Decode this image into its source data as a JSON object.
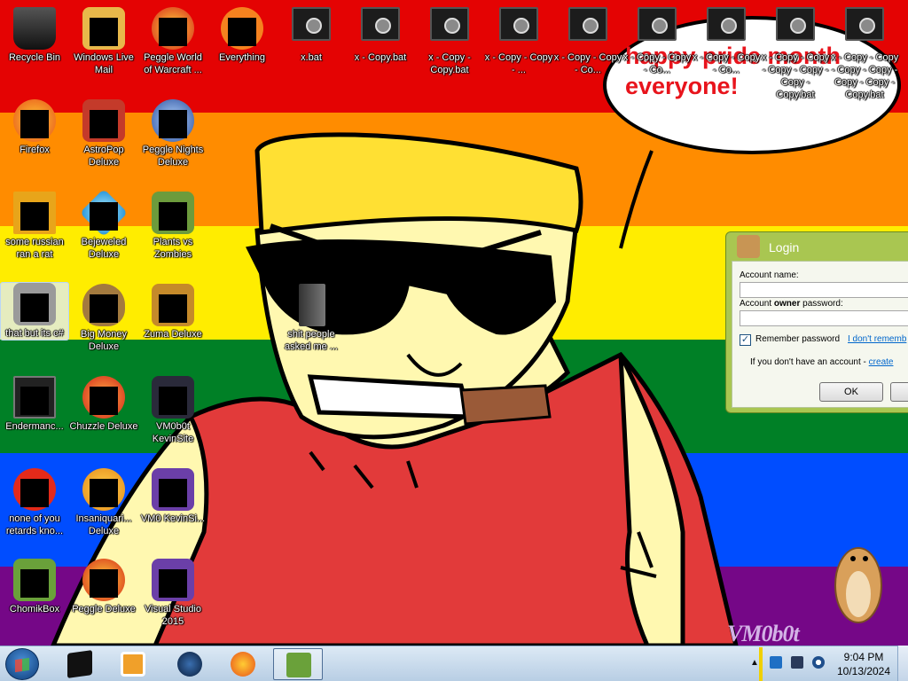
{
  "desktop": {
    "icons": [
      {
        "label": "Recycle Bin"
      },
      {
        "label": "Windows Live Mail"
      },
      {
        "label": "Peggle World of Warcraft ..."
      },
      {
        "label": "Everything"
      },
      {
        "label": "x.bat"
      },
      {
        "label": "x - Copy.bat"
      },
      {
        "label": "x - Copy - Copy.bat"
      },
      {
        "label": "x - Copy - Copy - ..."
      },
      {
        "label": "x - Copy - Copy - Co..."
      },
      {
        "label": "x - Copy - Copy - Co..."
      },
      {
        "label": "x - Copy - Copy - Co..."
      },
      {
        "label": "x - Copy - Copy - Copy - Copy - Copy - Copy.bat"
      },
      {
        "label": "x - Copy - Copy - Copy - Copy - Copy - Copy - Copy.bat"
      },
      {
        "label": "Firefox"
      },
      {
        "label": "AstroPop Deluxe"
      },
      {
        "label": "Peggle Nights Deluxe"
      },
      {
        "label": "some russian ran a rat"
      },
      {
        "label": "Bejeweled Deluxe"
      },
      {
        "label": "Plants vs Zombies"
      },
      {
        "label": "that but its c#"
      },
      {
        "label": "Big Money Deluxe"
      },
      {
        "label": "Zuma Deluxe"
      },
      {
        "label": "shit people asked me ..."
      },
      {
        "label": "Endermanc..."
      },
      {
        "label": "Chuzzle Deluxe"
      },
      {
        "label": "VM0b0t KevinSite"
      },
      {
        "label": "none of you retards kno..."
      },
      {
        "label": "Insaniquari... Deluxe"
      },
      {
        "label": "VM0 KevinSi..."
      },
      {
        "label": "ChomikBox"
      },
      {
        "label": "Peggle Deluxe"
      },
      {
        "label": "Visual Studio 2015"
      }
    ],
    "bubble_text": "happy pride month everyone!",
    "signature": "VM0b0t"
  },
  "login": {
    "title": "Login",
    "account_name_label": "Account name:",
    "password_label_pre": "Account ",
    "password_label_bold": "owner",
    "password_label_post": " password:",
    "remember_label": "Remember password",
    "remember_checked": "✓",
    "forgot_link": "I don't rememb",
    "no_account_text": "If you don't have an account - ",
    "create_link": "create",
    "ok_label": "OK"
  },
  "taskbar": {
    "time": "9:04 PM",
    "date": "10/13/2024"
  },
  "colors": {
    "stripe_red": "#e40303",
    "stripe_orange": "#ff8c00",
    "stripe_yellow": "#ffed00",
    "stripe_green": "#008026",
    "stripe_blue": "#004dff",
    "stripe_purple": "#750787"
  }
}
